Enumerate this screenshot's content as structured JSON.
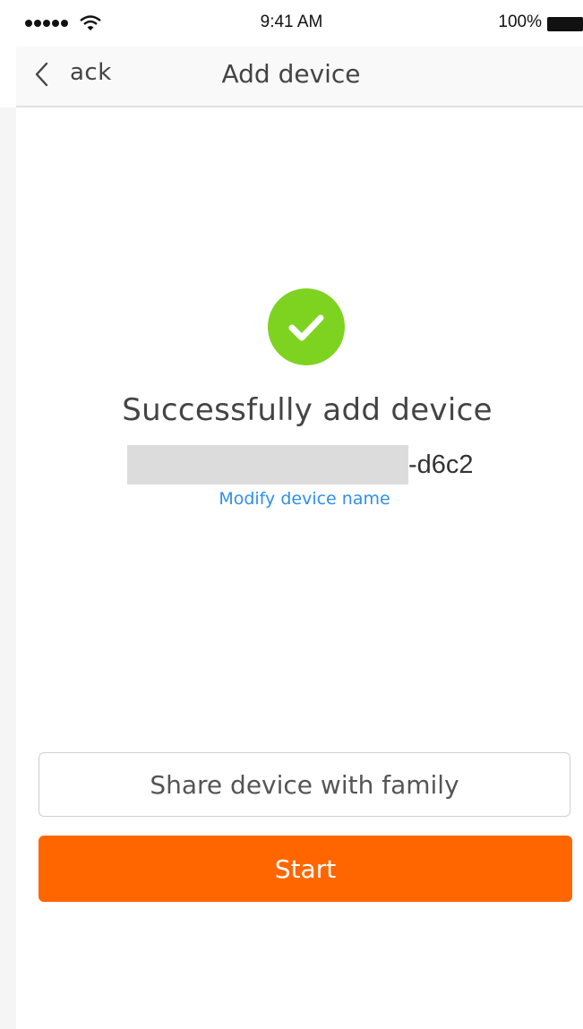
{
  "status_bar": {
    "time": "9:41 AM",
    "battery_percent": "100%",
    "signal_icon": "signal-dots-icon",
    "wifi_icon": "wifi-icon",
    "battery_icon": "battery-icon"
  },
  "nav": {
    "back_label": "ack",
    "back_icon": "chevron-left-icon",
    "title": "Add device"
  },
  "result": {
    "icon": "check-circle-icon",
    "title": "Successfully add device",
    "device_name_suffix": "-d6c2",
    "modify_link": "Modify device name"
  },
  "actions": {
    "share_label": "Share device with family",
    "start_label": "Start"
  },
  "colors": {
    "success_green": "#7ed321",
    "accent_orange": "#ff6600",
    "link_blue": "#2f8fe8"
  }
}
